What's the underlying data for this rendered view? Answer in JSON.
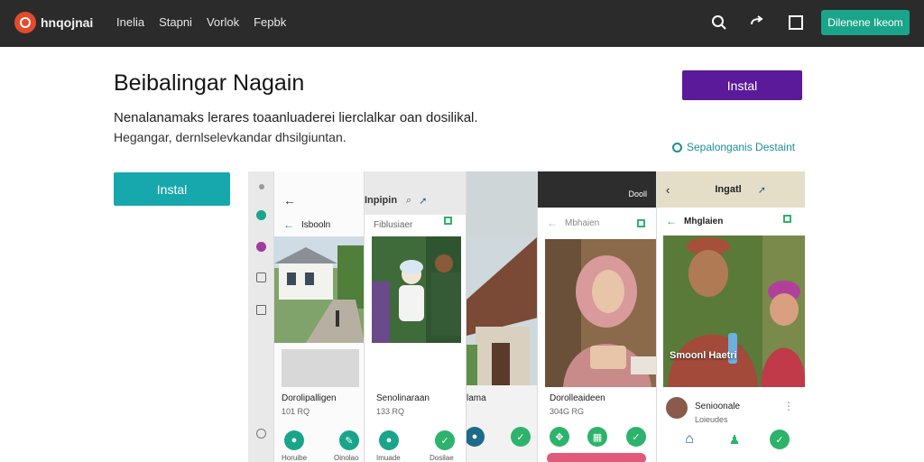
{
  "header": {
    "brand": "hnqojnai",
    "nav": [
      "Inelia",
      "Stapni",
      "Vorlok",
      "Fepbk"
    ],
    "cta": "Dilenene Ikeom",
    "icons": [
      "search-icon",
      "share-icon",
      "window-icon"
    ]
  },
  "hero": {
    "title": "Beibalingar Nagain",
    "desc_line1": "Nenalanamaks lerares toaanluaderei lierclalkar oan dosilikal.",
    "desc_line2": "Hegangar, dernlselevkandar dhsilgiuntan.",
    "install_top": "Instal",
    "install_left": "Instal",
    "secure_note": "Sepalonganis Destaint"
  },
  "colors": {
    "topbar": "#2b2b2b",
    "cta": "#1aa58a",
    "install_top": "#5b1a99",
    "install_left": "#17a8ad",
    "accent_teal": "#1d8e98"
  },
  "phones": {
    "p1": {
      "toolbar_title": "Inpipin",
      "sub_title": "Isbooln",
      "card_title": "Dorolipalligen",
      "card_sub": "101 RQ",
      "btn_labels": [
        "Horuibe",
        "Oinolao"
      ]
    },
    "p2": {
      "sub_title": "Fiblusiaer",
      "card_title": "Senolinaraan",
      "card_sub": "133 RQ",
      "btn_labels": [
        "Imuade",
        "Dosilae"
      ]
    },
    "p3": {
      "card_title": "lama"
    },
    "p4": {
      "status_text": "Dooll",
      "sub_title": "Mbhaien",
      "card_title": "Dorolleaideen",
      "card_sub": "304G RG"
    },
    "p5": {
      "toolbar_title": "Ingatl",
      "sub_title": "Mhglaien",
      "overlay": "Smoonl Haetri",
      "profile_name": "Senioonale",
      "profile_sub": "Loieudes"
    }
  }
}
